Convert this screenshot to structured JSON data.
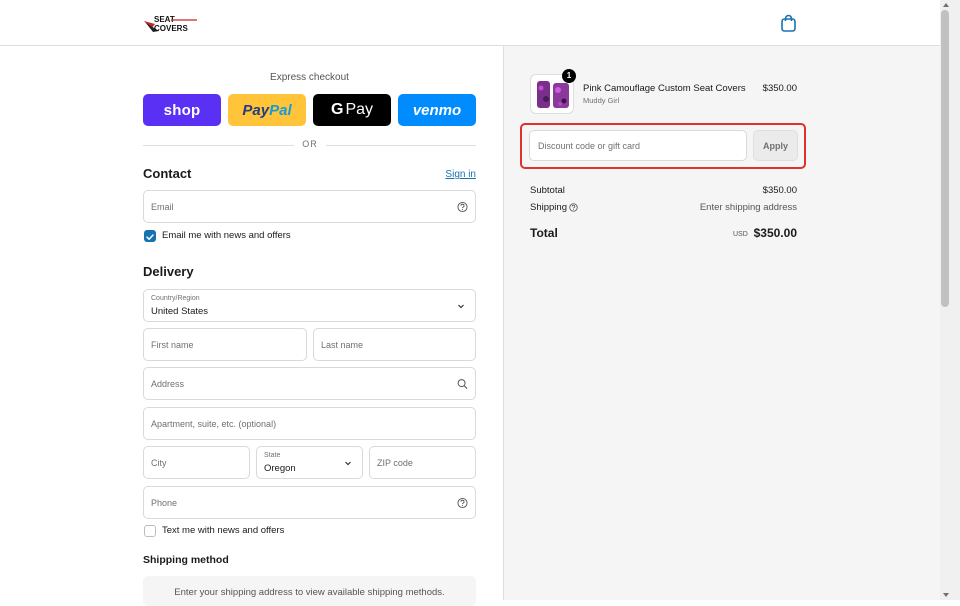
{
  "header": {
    "logo_line1": "SEAT",
    "logo_line2": "COVERS"
  },
  "express": {
    "title": "Express checkout",
    "shop_label": "shop",
    "paypal_a": "Pay",
    "paypal_b": "Pal",
    "gpay_g": "G",
    "gpay_label": "Pay",
    "venmo_label": "venmo",
    "or_label": "OR"
  },
  "contact": {
    "title": "Contact",
    "signin": "Sign in",
    "email_placeholder": "Email",
    "news_label": "Email me with news and offers",
    "news_checked": true
  },
  "delivery": {
    "title": "Delivery",
    "country_label": "Country/Region",
    "country_value": "United States",
    "first_name": "First name",
    "last_name": "Last name",
    "address": "Address",
    "apartment": "Apartment, suite, etc. (optional)",
    "city": "City",
    "state_label": "State",
    "state_value": "Oregon",
    "zip": "ZIP code",
    "phone": "Phone",
    "text_label": "Text me with news and offers",
    "text_checked": false
  },
  "shipping": {
    "title": "Shipping method",
    "info": "Enter your shipping address to view available shipping methods."
  },
  "order": {
    "quantity": "1",
    "product_name": "Pink Camouflage Custom Seat Covers",
    "variant": "Muddy Girl",
    "price": "$350.00",
    "discount_placeholder": "Discount code or gift card",
    "apply_label": "Apply",
    "subtotal_label": "Subtotal",
    "subtotal_value": "$350.00",
    "shipping_label": "Shipping",
    "shipping_value": "Enter shipping address",
    "total_label": "Total",
    "currency": "USD",
    "total_value": "$350.00"
  },
  "colors": {
    "accent": "#1773b0",
    "highlight": "#e03030",
    "shop": "#5a31f4",
    "paypal": "#ffc439",
    "venmo": "#008cff"
  },
  "icons": [
    "seat-covers-logo",
    "shopping-bag-icon",
    "help-circle-icon",
    "chevron-down-icon",
    "search-icon",
    "checkmark-icon"
  ]
}
